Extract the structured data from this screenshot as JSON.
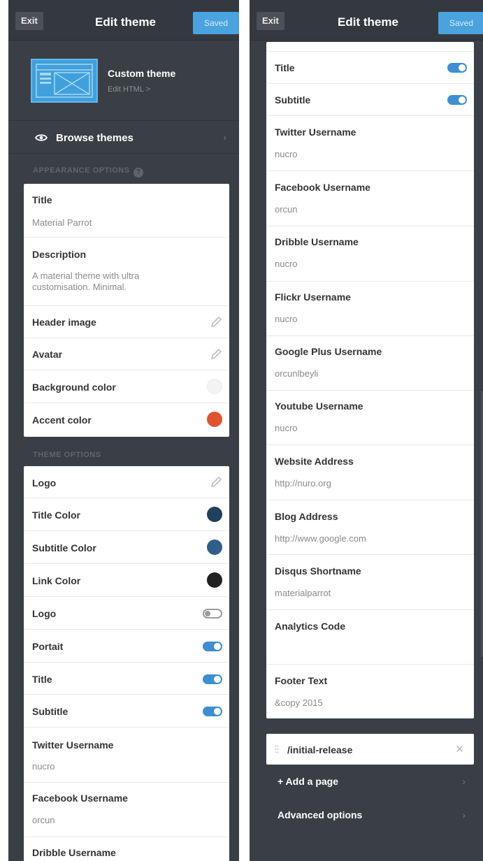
{
  "header": {
    "exit_label": "Exit",
    "title": "Edit theme",
    "saved_label": "Saved"
  },
  "theme": {
    "name": "Custom theme",
    "edit_html": "Edit HTML >"
  },
  "browse_themes": "Browse themes",
  "sections": {
    "appearance": "APPEARANCE OPTIONS",
    "theme": "THEME OPTIONS"
  },
  "appearance": {
    "title_label": "Title",
    "title_value": "Material Parrot",
    "description_label": "Description",
    "description_value": "A material theme with ultra customisation. Minimal.",
    "header_image": "Header image",
    "avatar": "Avatar",
    "background_color": "Background color",
    "accent_color": "Accent color"
  },
  "theme_options": {
    "logo": "Logo",
    "title_color": "Title Color",
    "subtitle_color": "Subtitle Color",
    "link_color": "Link Color",
    "logo_toggle": "Logo",
    "portait": "Portait",
    "title": "Title",
    "subtitle": "Subtitle",
    "twitter_label": "Twitter Username",
    "twitter_value": "nucro",
    "facebook_label": "Facebook Username",
    "facebook_value": "orcun",
    "dribble_label": "Dribble Username",
    "dribble_value": "nucro",
    "flickr_label": "Flickr Username",
    "flickr_value": "nucro",
    "gplus_label": "Google Plus Username",
    "gplus_value": "orcunlbeyli",
    "youtube_label": "Youtube Username",
    "youtube_value": "nucro",
    "website_label": "Website Address",
    "website_value": "http://nuro.org",
    "blog_label": "Blog Address",
    "blog_value": "http://www.google.com",
    "disqus_label": "Disqus Shortname",
    "disqus_value": "materialparrot",
    "analytics_label": "Analytics Code",
    "analytics_value": "",
    "footer_label": "Footer Text",
    "footer_value": "&copy 2015"
  },
  "pages": {
    "item": "/initial-release",
    "add_page": "+ Add a page",
    "advanced": "Advanced options"
  },
  "colors": {
    "background_color": "#f3f3f3",
    "accent_color": "#e0532d",
    "title_color": "#1f3f5b",
    "subtitle_color": "#2f5f86",
    "link_color": "#222222",
    "toggle_on": "#3d8fd1",
    "saved_button": "#4aa3df"
  },
  "icons": {
    "eye": "eye-icon",
    "pencil": "pencil-icon",
    "help": "help-icon",
    "chevron": "chevron-right-icon",
    "close": "close-icon",
    "drag": "drag-handle-icon"
  }
}
